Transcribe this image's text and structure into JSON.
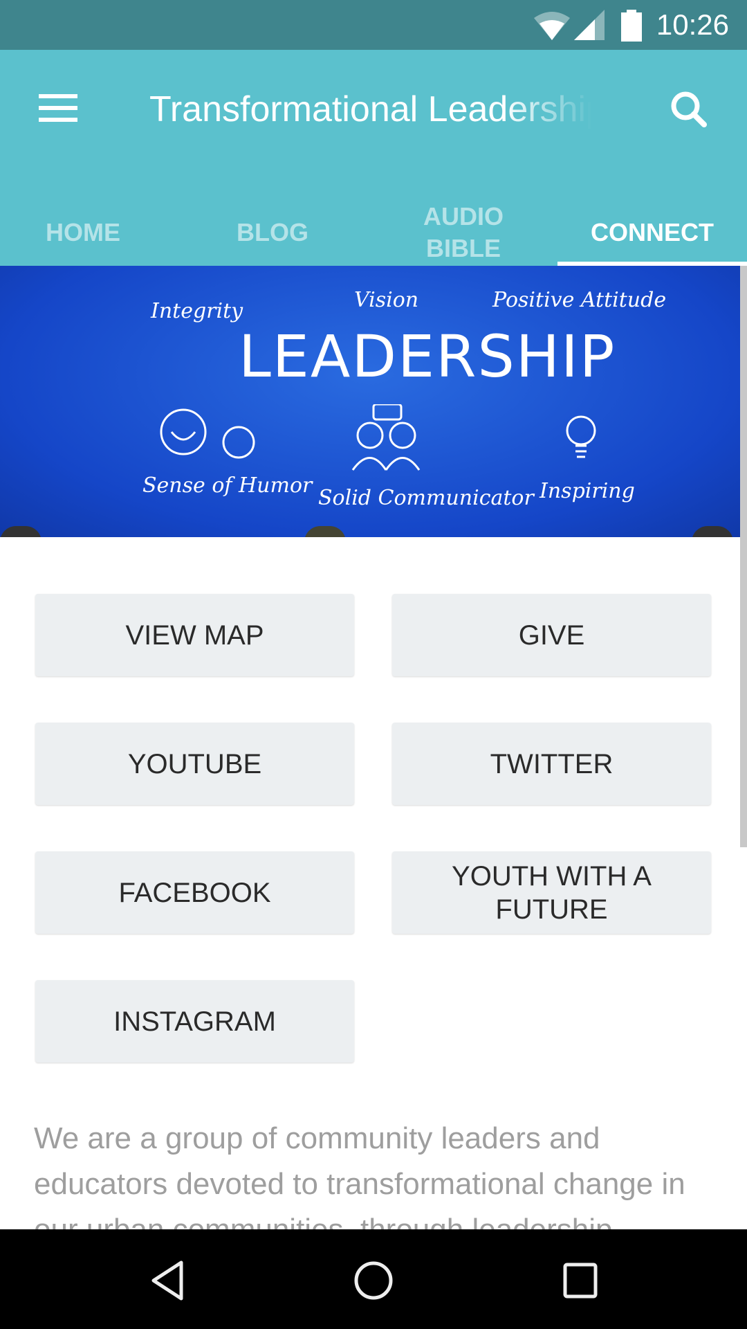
{
  "status_bar": {
    "time": "10:26",
    "icons": [
      "wifi-icon",
      "cell-signal-icon",
      "battery-icon"
    ]
  },
  "toolbar": {
    "title": "Transformational Leadership",
    "menu_icon": "hamburger-menu-icon",
    "search_icon": "search-icon",
    "color": "#5bc1cd"
  },
  "tabs": [
    {
      "label": "HOME"
    },
    {
      "label": "BLOG"
    },
    {
      "label": "AUDIO BIBLE"
    },
    {
      "label": "CONNECT",
      "active": true
    }
  ],
  "banner": {
    "heading": "LEADERSHIP",
    "words": [
      "Integrity",
      "Vision",
      "Positive Attitude",
      "Sense of Humor",
      "Solid Communicator",
      "Inspiring"
    ]
  },
  "buttons": [
    "VIEW MAP",
    "GIVE",
    "YOUTUBE",
    "TWITTER",
    "FACEBOOK",
    "YOUTH WITH A FUTURE",
    "INSTAGRAM"
  ],
  "description": "We are a group of community leaders and educators devoted to transformational change in our urban communities, through leadership",
  "nav_bar": {
    "icons": [
      "back-icon",
      "home-icon",
      "recents-icon"
    ]
  }
}
